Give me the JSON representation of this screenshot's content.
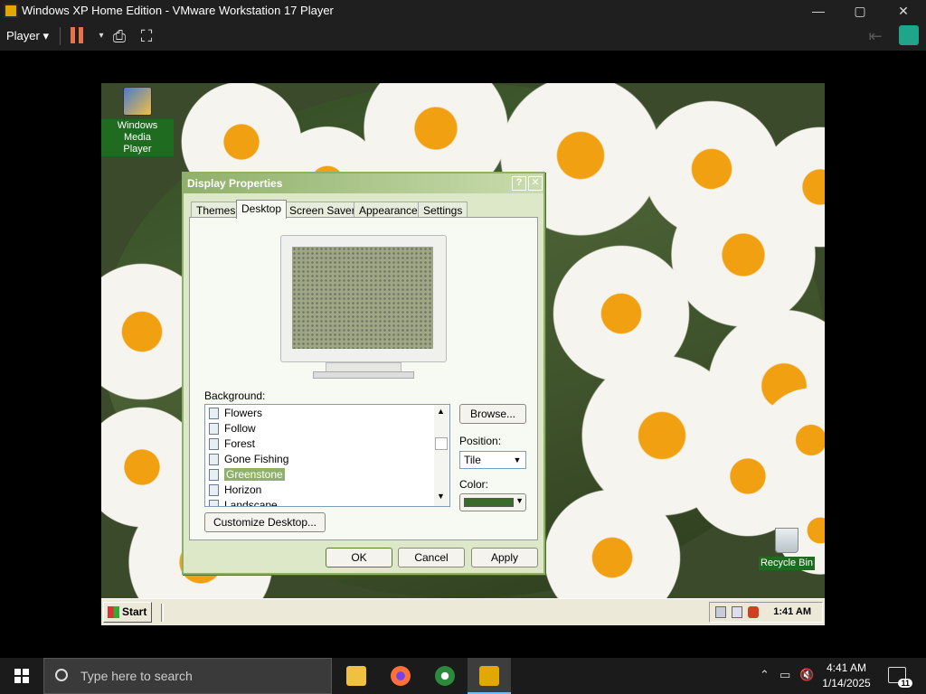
{
  "host_window": {
    "title": "Windows XP Home Edition - VMware Workstation 17 Player",
    "minimize_glyph": "—",
    "maximize_glyph": "▢",
    "close_glyph": "✕",
    "player_menu": "Player ▾",
    "toolbar_icons": [
      "pause-icon",
      "send-ctrl-alt-del-icon",
      "fullscreen-icon",
      "unity-icon"
    ]
  },
  "desktop": {
    "icons": [
      {
        "label_line1": "Windows Media",
        "label_line2": "Player",
        "icon": "windows-media-player-icon"
      },
      {
        "label_line1": "Recycle Bin",
        "icon": "recycle-bin-icon"
      }
    ]
  },
  "dialog": {
    "title": "Display Properties",
    "help_glyph": "?",
    "close_glyph": "✕",
    "tabs": [
      {
        "label": "Themes",
        "active": false
      },
      {
        "label": "Desktop",
        "active": true
      },
      {
        "label": "Screen Saver",
        "active": false
      },
      {
        "label": "Appearance",
        "active": false
      },
      {
        "label": "Settings",
        "active": false
      }
    ],
    "background_label": "Background:",
    "backgrounds": [
      {
        "name": "Flowers",
        "selected": false
      },
      {
        "name": "Follow",
        "selected": false
      },
      {
        "name": "Forest",
        "selected": false
      },
      {
        "name": "Gone Fishing",
        "selected": false
      },
      {
        "name": "Greenstone",
        "selected": true
      },
      {
        "name": "Horizon",
        "selected": false
      },
      {
        "name": "Landscape",
        "selected": false
      }
    ],
    "browse_label": "Browse...",
    "position_label": "Position:",
    "position_value": "Tile",
    "color_label": "Color:",
    "color_value": "#3a6b2a",
    "customize_label": "Customize Desktop...",
    "ok_label": "OK",
    "cancel_label": "Cancel",
    "apply_label": "Apply"
  },
  "xp_taskbar": {
    "start_label": "Start",
    "clock": "1:41 AM"
  },
  "host_taskbar": {
    "search_placeholder": "Type here to search",
    "apps": [
      "file-explorer-icon",
      "firefox-icon",
      "internet-explorer-icon",
      "vmware-player-icon"
    ],
    "time": "4:41 AM",
    "date": "1/14/2025",
    "notification_count": "11"
  },
  "colors": {
    "xp_theme_accent": "#8fb06a",
    "vmware_chrome": "#1f1f1f",
    "win10_taskbar": "#1b1b1b"
  }
}
